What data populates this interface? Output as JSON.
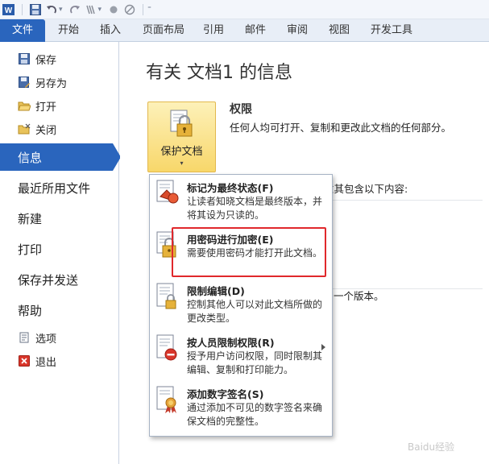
{
  "qat": {
    "icons": [
      "word-logo-icon",
      "save-icon",
      "undo-icon",
      "redo-icon",
      "format-painter-icon",
      "circle-icon",
      "no-entry-icon",
      "customize-icon"
    ]
  },
  "tabs": [
    "文件",
    "开始",
    "插入",
    "页面布局",
    "引用",
    "邮件",
    "审阅",
    "视图",
    "开发工具"
  ],
  "leftnav": {
    "save": "保存",
    "save_as": "另存为",
    "open": "打开",
    "close": "关闭",
    "info": "信息",
    "recent": "最近所用文件",
    "new": "新建",
    "print": "打印",
    "save_send": "保存并发送",
    "help": "帮助",
    "options": "选项",
    "exit": "退出"
  },
  "main": {
    "title": "有关 文档1 的信息",
    "protect_button": "保护文档",
    "permissions_title": "权限",
    "permissions_desc": "任何人均可打开、复制和更改此文档的任何部分。",
    "partial_text_1": "意其包含以下内容:",
    "partial_text_2": "一个版本。"
  },
  "menu": {
    "items": [
      {
        "title": "标记为最终状态(F)",
        "desc": "让读者知晓文档是最终版本，并将其设为只读的。",
        "icon": "mark-final-icon"
      },
      {
        "title": "用密码进行加密(E)",
        "desc": "需要使用密码才能打开此文档。",
        "icon": "encrypt-lock-icon"
      },
      {
        "title": "限制编辑(D)",
        "desc": "控制其他人可以对此文档所做的更改类型。",
        "icon": "restrict-editing-icon"
      },
      {
        "title": "按人员限制权限(R)",
        "desc": "授予用户访问权限，同时限制其编辑、复制和打印能力。",
        "icon": "restrict-permission-icon"
      },
      {
        "title": "添加数字签名(S)",
        "desc": "通过添加不可见的数字签名来确保文档的完整性。",
        "icon": "digital-signature-icon"
      }
    ]
  },
  "watermark": "Baidu经验",
  "colors": {
    "accent": "#2a65bd",
    "highlight": "#e0282c",
    "protect_button": "#f8d76a"
  }
}
